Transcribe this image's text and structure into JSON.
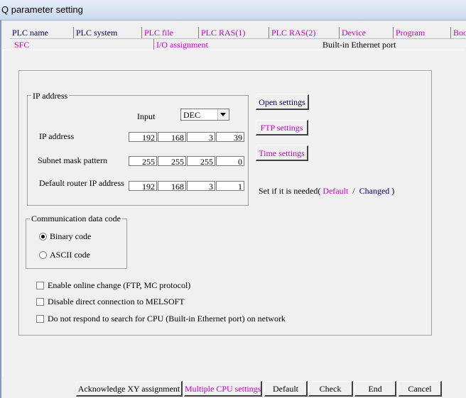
{
  "window": {
    "title": "Q parameter setting"
  },
  "tabs_row1": [
    {
      "label": "PLC name",
      "color": "navy"
    },
    {
      "label": "PLC system",
      "color": "navy"
    },
    {
      "label": "PLC file",
      "color": "pink"
    },
    {
      "label": "PLC RAS(1)",
      "color": "pink"
    },
    {
      "label": "PLC RAS(2)",
      "color": "pink"
    },
    {
      "label": "Device",
      "color": "pink"
    },
    {
      "label": "Program",
      "color": "pink"
    },
    {
      "label": "Boo",
      "color": "pink"
    }
  ],
  "tabs_row2": [
    {
      "label": "SFC",
      "color": "pink"
    },
    {
      "label": "I/O assignment",
      "color": "pink"
    },
    {
      "label": "Built-in Ethernet port",
      "color": "black"
    }
  ],
  "ip_group": {
    "legend": "IP address",
    "input_label": "Input",
    "input_mode": "DEC",
    "rows": [
      {
        "label": "IP address",
        "octets": [
          "192",
          "168",
          "3",
          "39"
        ]
      },
      {
        "label": "Subnet mask pattern",
        "octets": [
          "255",
          "255",
          "255",
          "0"
        ]
      },
      {
        "label": "Default router IP address",
        "octets": [
          "192",
          "168",
          "3",
          "1"
        ]
      }
    ]
  },
  "side_buttons": {
    "open": "Open settings",
    "ftp": "FTP settings",
    "time": "Time settings"
  },
  "legend_note": {
    "prefix": "Set if it is needed(",
    "default": "Default",
    "slash": "/",
    "changed": "Changed",
    "suffix": ")"
  },
  "comm_group": {
    "legend": "Communication data code",
    "options": [
      {
        "label": "Binary code",
        "selected": true
      },
      {
        "label": "ASCII code",
        "selected": false
      }
    ]
  },
  "checkboxes": [
    {
      "label": "Enable online change (FTP, MC protocol)",
      "checked": false
    },
    {
      "label": "Disable direct connection to MELSOFT",
      "checked": false
    },
    {
      "label": "Do not respond to search for CPU (Built-in Ethernet port) on network",
      "checked": false
    }
  ],
  "bottom_buttons": {
    "ack": "Acknowledge XY assignment",
    "multi": "Multiple CPU settings",
    "default": "Default",
    "check": "Check",
    "end": "End",
    "cancel": "Cancel"
  },
  "colors": {
    "pink": "#cc00cc",
    "navy": "#000066"
  }
}
